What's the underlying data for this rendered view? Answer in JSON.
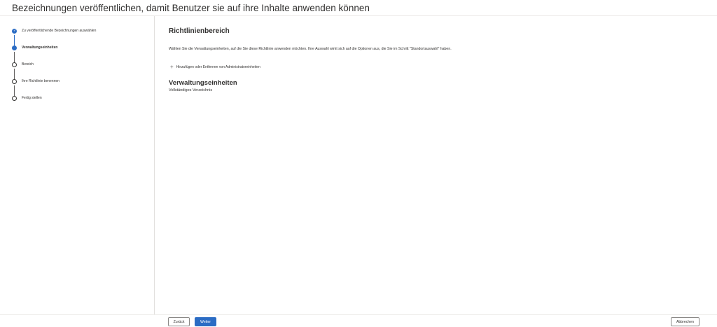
{
  "header": {
    "title": "Bezeichnungen veröffentlichen, damit Benutzer sie auf ihre Inhalte anwenden können"
  },
  "wizard": {
    "steps": [
      {
        "label": "Zu veröffentlichende Bezeichnungen auswählen",
        "state": "completed"
      },
      {
        "label": "Verwaltungseinheiten",
        "state": "current"
      },
      {
        "label": "Bereich",
        "state": "pending"
      },
      {
        "label": "Ihre Richtlinie benennen",
        "state": "pending"
      },
      {
        "label": "Fertig stellen",
        "state": "pending"
      }
    ],
    "check_glyph": "✓"
  },
  "main": {
    "section_title": "Richtlinienbereich",
    "description": "Wählen Sie die Verwaltungseinheiten, auf die Sie diese Richtlinie anwenden möchten. Ihre Auswahl wirkt sich auf die Optionen aus, die Sie im Schritt \"Standortauswahl\" haben.",
    "add_icon": "+",
    "add_link_label": "Hinzufügen oder Entfernen von Administratoreinheiten",
    "units_title": "Verwaltungseinheiten",
    "units_value": "Vollständiges Verzeichnis"
  },
  "footer": {
    "back_label": "Zurück",
    "next_label": "Weiter",
    "cancel_label": "Abbrechen"
  },
  "colors": {
    "accent": "#2b6cc4",
    "text": "#323130",
    "border": "#e1dfdd"
  },
  "icons": {
    "step_completed": "check-icon",
    "add": "plus-icon"
  }
}
